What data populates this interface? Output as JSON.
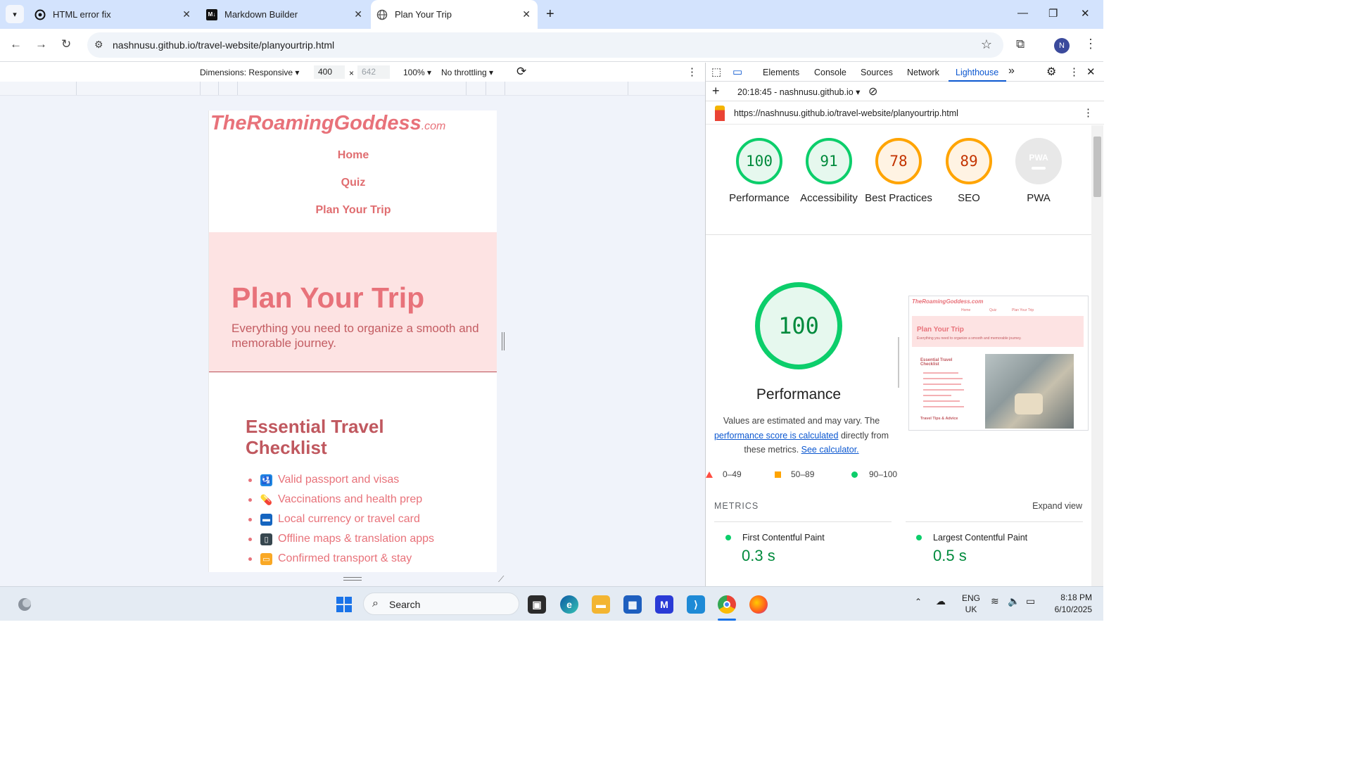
{
  "browser": {
    "tabs": [
      {
        "title": "HTML error fix",
        "close": "✕"
      },
      {
        "title": "Markdown Builder",
        "close": "✕"
      },
      {
        "title": "Plan Your Trip",
        "close": "✕"
      }
    ],
    "new_tab": "+",
    "url": "nashnusu.github.io/travel-website/planyourtrip.html",
    "profile_initial": "N"
  },
  "device_toolbar": {
    "dimensions": "Dimensions: Responsive ▾",
    "width": "400",
    "times": "×",
    "height": "642",
    "zoom": "100% ▾",
    "throttling": "No throttling ▾"
  },
  "site": {
    "logo": "TheRoamingGoddess",
    "logo_suffix": ".com",
    "nav": [
      "Home",
      "Quiz",
      "Plan Your Trip"
    ],
    "hero_title": "Plan Your Trip",
    "hero_subtitle": "Everything you need to organize a smooth and memorable journey.",
    "section_title": "Essential Travel Checklist",
    "checklist": [
      {
        "icon": "passport-control-icon",
        "text": "Valid passport and visas",
        "color": "#1e88e5"
      },
      {
        "icon": "pill-icon",
        "text": "Vaccinations and health prep",
        "color": "#e53935"
      },
      {
        "icon": "credit-card-icon",
        "text": "Local currency or travel card",
        "color": "#1565c0"
      },
      {
        "icon": "mobile-phone-icon",
        "text": "Offline maps & translation apps",
        "color": "#37474f"
      },
      {
        "icon": "ticket-icon",
        "text": "Confirmed transport & stay",
        "color": "#f9a825"
      }
    ]
  },
  "devtools": {
    "tabs": [
      "Elements",
      "Console",
      "Sources",
      "Network",
      "Lighthouse"
    ],
    "active_tab": "Lighthouse",
    "more": "»",
    "report": "20:18:45 - nashnusu.github.io ▾",
    "report_url": "https://nashnusu.github.io/travel-website/planyourtrip.html",
    "scores": [
      {
        "value": "100",
        "label": "Performance",
        "status": "green"
      },
      {
        "value": "91",
        "label": "Accessibility",
        "status": "green"
      },
      {
        "value": "78",
        "label": "Best Practices",
        "status": "orange"
      },
      {
        "value": "89",
        "label": "SEO",
        "status": "orange"
      },
      {
        "value": "PWA",
        "label": "PWA",
        "status": "gray"
      }
    ],
    "perf_score": "100",
    "perf_title": "Performance",
    "perf_note_1": "Values are estimated and may vary. The ",
    "perf_note_link": "performance score is calculated",
    "perf_note_2": " directly from these metrics. ",
    "perf_note_calc": "See calculator.",
    "legend": [
      "0–49",
      "50–89",
      "90–100"
    ],
    "metrics_heading": "METRICS",
    "expand_view": "Expand view",
    "metrics": [
      {
        "name": "First Contentful Paint",
        "value": "0.3 s"
      },
      {
        "name": "Largest Contentful Paint",
        "value": "0.5 s"
      }
    ],
    "screenshot": {
      "logo": "TheRoamingGoddess.com",
      "nav": [
        "Home",
        "Quiz",
        "Plan Your Trip"
      ],
      "title": "Plan Your Trip",
      "subtitle": "Everything you need to organize a smooth and memorable journey.",
      "section": "Essential Travel Checklist",
      "tips": "Travel Tips & Advice"
    }
  },
  "taskbar": {
    "search": "Search",
    "lang_1": "ENG",
    "lang_2": "UK",
    "time": "8:18 PM",
    "date": "6/10/2025"
  }
}
